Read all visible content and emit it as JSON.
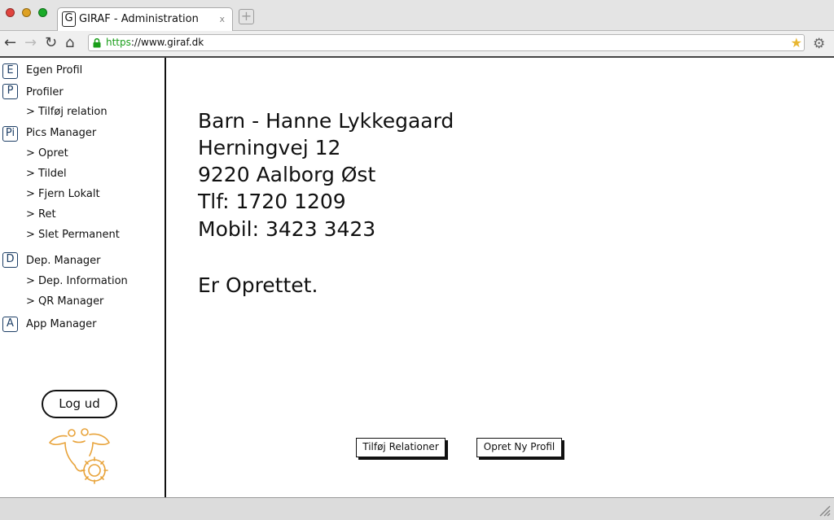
{
  "browser": {
    "tab_title": "GIRAF - Administration",
    "tab_favicon_letter": "G",
    "tab_close": "x",
    "url_scheme": "https",
    "url_rest": "://www.giraf.dk"
  },
  "sidebar": {
    "sections": [
      {
        "badge": "E",
        "label": "Egen Profil"
      },
      {
        "badge": "P",
        "label": "Profiler"
      },
      {
        "badge": "Pi",
        "label": "Pics Manager"
      },
      {
        "badge": "D",
        "label": "Dep. Manager"
      },
      {
        "badge": "A",
        "label": "App Manager"
      }
    ],
    "subitems": [
      "> Tilføj relation",
      "> Opret",
      "> Tildel",
      "> Fjern Lokalt",
      "> Ret",
      "> Slet Permanent",
      "> Dep. Information",
      "> QR Manager"
    ],
    "logout_label": "Log ud"
  },
  "main": {
    "lines": [
      "Barn - Hanne Lykkegaard",
      "Herningvej 12",
      "9220 Aalborg Øst",
      "Tlf: 1720 1209",
      "Mobil: 3423 3423"
    ],
    "status": "Er Oprettet.",
    "buttons": {
      "add_relations": "Tilføj Relationer",
      "create_profile": "Opret Ny Profil"
    }
  },
  "colors": {
    "logo_accent": "#e8a33a",
    "badge_border": "#1e3f66",
    "https_green": "#1a9e1a"
  }
}
